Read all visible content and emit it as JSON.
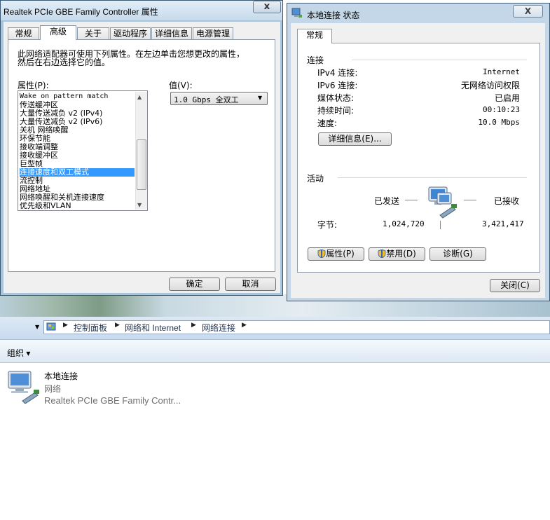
{
  "adv_dialog": {
    "title": "Realtek PCIe GBE Family Controller 属性",
    "close_glyph": "x",
    "tabs": [
      "常规",
      "高级",
      "关于",
      "驱动程序",
      "详细信息",
      "电源管理"
    ],
    "description_line1": "此网络适配器可使用下列属性。在左边单击您想更改的属性，",
    "description_line2": "然后在右边选择它的值。",
    "property_label": "属性(P):",
    "value_label": "值(V):",
    "value_selected": "1.0 Gbps 全双工",
    "properties": [
      "Wake on pattern match",
      "传送缓冲区",
      "大量传送减负 v2 (IPv4)",
      "大量传送减负 v2 (IPv6)",
      "关机 网络唤醒",
      "环保节能",
      "接收端调整",
      "接收缓冲区",
      "巨型帧",
      "连接速度和双工模式",
      "流控制",
      "网络地址",
      "网络唤醒和关机连接速度",
      "优先级和VLAN"
    ],
    "selected_index": 9,
    "ok_label": "确定",
    "cancel_label": "取消"
  },
  "status_dialog": {
    "title": "本地连接 状态",
    "close_glyph": "X",
    "tab": "常规",
    "connection_group": "连接",
    "rows": [
      {
        "label": "IPv4 连接:",
        "value": "Internet"
      },
      {
        "label": "IPv6 连接:",
        "value": "无网络访问权限"
      },
      {
        "label": "媒体状态:",
        "value": "已启用"
      },
      {
        "label": "持续时间:",
        "value": "00:10:23"
      },
      {
        "label": "速度:",
        "value": "10.0 Mbps"
      }
    ],
    "details_button": "详细信息(E)...",
    "activity_group": "活动",
    "sent_label": "已发送",
    "received_label": "已接收",
    "bytes_label": "字节:",
    "bytes_sent": "1,024,720",
    "bytes_received": "3,421,417",
    "properties_button": "属性(P)",
    "disable_button": "禁用(D)",
    "diagnose_button": "诊断(G)",
    "close_button": "关闭(C)"
  },
  "explorer": {
    "breadcrumbs": [
      "控制面板",
      "网络和 Internet",
      "网络连接"
    ],
    "organize_label": "组织 ▾",
    "connection": {
      "name": "本地连接",
      "type": "网络",
      "adapter": "Realtek PCIe GBE Family Contr..."
    }
  }
}
